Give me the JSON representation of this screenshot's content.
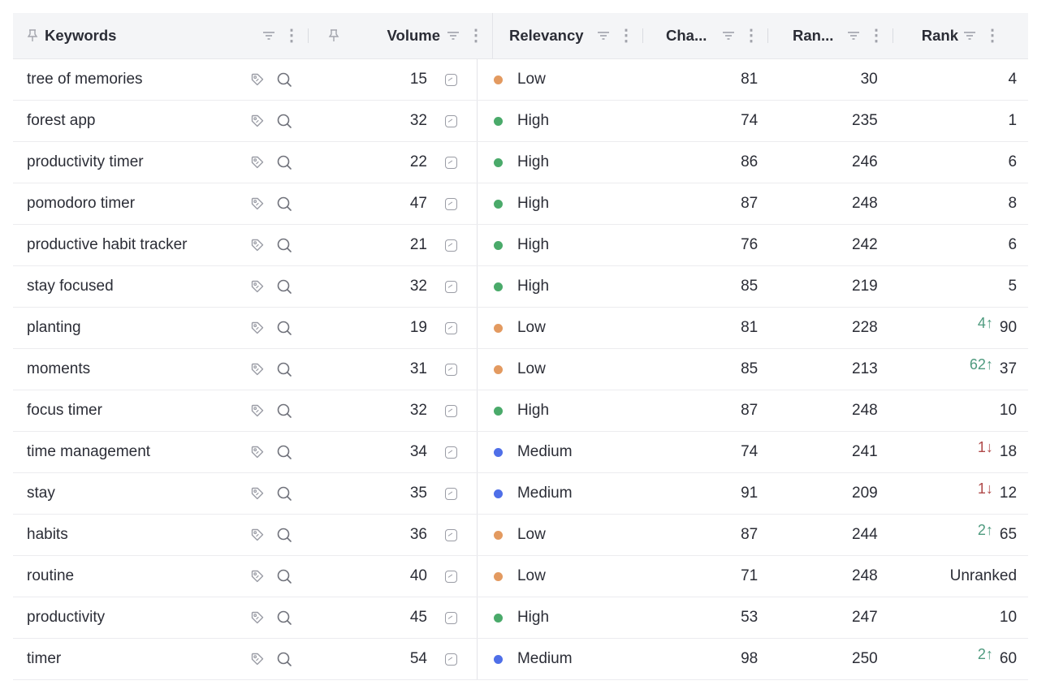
{
  "columns": {
    "keywords": "Keywords",
    "volume": "Volume",
    "relevancy": "Relevancy",
    "chance": "Cha...",
    "ranked": "Ran...",
    "rank": "Rank"
  },
  "colors": {
    "low": "#e39a60",
    "high": "#4aaa6a",
    "medium": "#4f6fe8",
    "up": "#4e9a7e",
    "down": "#b04a4a"
  },
  "icons": {
    "pin": "pin-icon",
    "filter": "filter-icon",
    "menu": "more-vertical-icon",
    "tag": "tag-icon",
    "search": "search-icon",
    "trend": "trend-chart-icon"
  },
  "rows": [
    {
      "keyword": "tree of memories",
      "volume": "15",
      "relevancy": "Low",
      "level": "low",
      "chance": "81",
      "ranked": "30",
      "change": "",
      "dir": "",
      "rank": "4"
    },
    {
      "keyword": "forest app",
      "volume": "32",
      "relevancy": "High",
      "level": "high",
      "chance": "74",
      "ranked": "235",
      "change": "",
      "dir": "",
      "rank": "1"
    },
    {
      "keyword": "productivity timer",
      "volume": "22",
      "relevancy": "High",
      "level": "high",
      "chance": "86",
      "ranked": "246",
      "change": "",
      "dir": "",
      "rank": "6"
    },
    {
      "keyword": "pomodoro timer",
      "volume": "47",
      "relevancy": "High",
      "level": "high",
      "chance": "87",
      "ranked": "248",
      "change": "",
      "dir": "",
      "rank": "8"
    },
    {
      "keyword": "productive habit tracker",
      "volume": "21",
      "relevancy": "High",
      "level": "high",
      "chance": "76",
      "ranked": "242",
      "change": "",
      "dir": "",
      "rank": "6"
    },
    {
      "keyword": "stay focused",
      "volume": "32",
      "relevancy": "High",
      "level": "high",
      "chance": "85",
      "ranked": "219",
      "change": "",
      "dir": "",
      "rank": "5"
    },
    {
      "keyword": "planting",
      "volume": "19",
      "relevancy": "Low",
      "level": "low",
      "chance": "81",
      "ranked": "228",
      "change": "4",
      "dir": "up",
      "rank": "90"
    },
    {
      "keyword": "moments",
      "volume": "31",
      "relevancy": "Low",
      "level": "low",
      "chance": "85",
      "ranked": "213",
      "change": "62",
      "dir": "up",
      "rank": "37"
    },
    {
      "keyword": "focus timer",
      "volume": "32",
      "relevancy": "High",
      "level": "high",
      "chance": "87",
      "ranked": "248",
      "change": "",
      "dir": "",
      "rank": "10"
    },
    {
      "keyword": "time management",
      "volume": "34",
      "relevancy": "Medium",
      "level": "medium",
      "chance": "74",
      "ranked": "241",
      "change": "1",
      "dir": "down",
      "rank": "18"
    },
    {
      "keyword": "stay",
      "volume": "35",
      "relevancy": "Medium",
      "level": "medium",
      "chance": "91",
      "ranked": "209",
      "change": "1",
      "dir": "down",
      "rank": "12"
    },
    {
      "keyword": "habits",
      "volume": "36",
      "relevancy": "Low",
      "level": "low",
      "chance": "87",
      "ranked": "244",
      "change": "2",
      "dir": "up",
      "rank": "65"
    },
    {
      "keyword": "routine",
      "volume": "40",
      "relevancy": "Low",
      "level": "low",
      "chance": "71",
      "ranked": "248",
      "change": "",
      "dir": "",
      "rank": "Unranked"
    },
    {
      "keyword": "productivity",
      "volume": "45",
      "relevancy": "High",
      "level": "high",
      "chance": "53",
      "ranked": "247",
      "change": "",
      "dir": "",
      "rank": "10"
    },
    {
      "keyword": "timer",
      "volume": "54",
      "relevancy": "Medium",
      "level": "medium",
      "chance": "98",
      "ranked": "250",
      "change": "2",
      "dir": "up",
      "rank": "60"
    }
  ]
}
